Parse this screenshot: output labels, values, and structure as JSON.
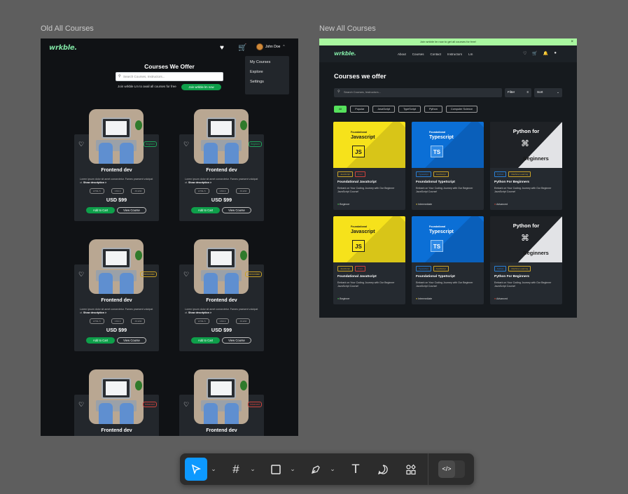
{
  "frames": {
    "old_label": "Old All Courses",
    "new_label": "New All Courses"
  },
  "old": {
    "logo": "wrkble.",
    "user_name": "John Doe",
    "dropdown": [
      "My Courses",
      "Explore",
      "Settings"
    ],
    "title": "Courses We Offer",
    "search_placeholder": "Search Courses, Instructors...",
    "join_text": "Join wrkble Lm to avail all courses for free",
    "join_button": "Join wrkble lm now",
    "cards": [
      {
        "title": "Frontend dev",
        "badge": "Beginner",
        "badge_color": "#1fa35a",
        "desc": "Lorem ipsum dolor sit amet consectetur. Fames praesent volutpat ut.",
        "more": "Show description >",
        "tags": [
          "HTML 5",
          "CSS 3",
          "JS ES6"
        ],
        "price": "USD $99",
        "add": "Add to Cart",
        "view": "View Course"
      },
      {
        "title": "Frontend dev",
        "badge": "Beginner",
        "badge_color": "#1fa35a",
        "desc": "Lorem ipsum dolor sit amet consectetur. Fames praesent volutpat ut.",
        "more": "Show description >",
        "tags": [
          "HTML 5",
          "CSS 3",
          "JS ES6"
        ],
        "price": "USD $99",
        "add": "Add to Cart",
        "view": "View Course"
      },
      {
        "title": "Frontend dev",
        "badge": "Intermediate",
        "badge_color": "#c9a227",
        "desc": "Lorem ipsum dolor sit amet consectetur. Fames praesent volutpat ut.",
        "more": "Show description >",
        "tags": [
          "HTML 5",
          "CSS 3",
          "JS ES6"
        ],
        "price": "USD $99",
        "add": "Add to Cart",
        "view": "View Course"
      },
      {
        "title": "Frontend dev",
        "badge": "Intermediate",
        "badge_color": "#c9a227",
        "desc": "Lorem ipsum dolor sit amet consectetur. Fames praesent volutpat ut.",
        "more": "Show description >",
        "tags": [
          "HTML 5",
          "CSS 3",
          "JS ES6"
        ],
        "price": "USD $99",
        "add": "Add to Cart",
        "view": "View Course"
      },
      {
        "title": "Frontend dev",
        "badge": "Advanced",
        "badge_color": "#d0433d"
      },
      {
        "title": "Frontend dev",
        "badge": "Advanced",
        "badge_color": "#d0433d"
      }
    ]
  },
  "new": {
    "banner": "Join wrkble lm now to get all courses for free!",
    "logo": "wrkble.",
    "nav": [
      "About",
      "Courses",
      "Contact",
      "Instructors",
      "Lm"
    ],
    "title": "Courses we offer",
    "search_placeholder": "Search Courses, Instructors...",
    "filter": "Filter",
    "sort": "Sort",
    "chips": [
      "All",
      "Popular",
      "JavaScript",
      "TypeScript",
      "Python",
      "Computer Science"
    ],
    "cards": [
      {
        "kind": "js",
        "pre": "Foundational",
        "name": "Javascript",
        "logo": "JS",
        "tags": [
          "JavaScript",
          "Front"
        ],
        "title": "Foundational JavaScript",
        "desc": "Embark on Your Coding Journey with Our Beginner JavaScript Course!",
        "level": "Beginner",
        "level_color": "#56e15c"
      },
      {
        "kind": "ts",
        "pre": "Foundational",
        "name": "Typescript",
        "logo": "TS",
        "tags": [
          "Typescript",
          "JavaScript"
        ],
        "title": "Foundational TypeScript",
        "desc": "Embark on Your Coding Journey with Our Beginner JavaScript Course!",
        "level": "Intermediate",
        "level_color": "#e7c83a"
      },
      {
        "kind": "py",
        "pre": "Python for",
        "name": "Beginners",
        "logo": "",
        "tags": [
          "Python",
          "Machine Learning"
        ],
        "title": "Python For Beginners",
        "desc": "Embark on Your Coding Journey with Our Beginner JavaScript Course!",
        "level": "Advanced",
        "level_color": "#e2503f"
      },
      {
        "kind": "js",
        "pre": "Foundational",
        "name": "Javascript",
        "logo": "JS",
        "tags": [
          "JavaScript",
          "Front"
        ],
        "title": "Foundational JavaScript",
        "desc": "Embark on Your Coding Journey with Our Beginner JavaScript Course!",
        "level": "Beginner",
        "level_color": "#56e15c"
      },
      {
        "kind": "ts",
        "pre": "Foundational",
        "name": "Typescript",
        "logo": "TS",
        "tags": [
          "Typescript",
          "JavaScript"
        ],
        "title": "Foundational TypeScript",
        "desc": "Embark on Your Coding Journey with Our Beginner JavaScript Course!",
        "level": "Intermediate",
        "level_color": "#e7c83a"
      },
      {
        "kind": "py",
        "pre": "Python for",
        "name": "Beginners",
        "logo": "",
        "tags": [
          "Python",
          "Machine Learning"
        ],
        "title": "Python For Beginners",
        "desc": "Embark on Your Coding Journey with Our Beginner JavaScript Course!",
        "level": "Advanced",
        "level_color": "#e2503f"
      }
    ]
  },
  "toolbar": {
    "tools": [
      "move-tool",
      "frame-tool",
      "shape-tool",
      "pen-tool",
      "text-tool",
      "comment-tool",
      "components-tool"
    ],
    "selected": "move-tool",
    "code_toggle": "dev-mode"
  },
  "colors": {
    "accent": "#0d99ff",
    "brand_green": "#0e9f4a",
    "canvas": "#5e5e5e"
  }
}
